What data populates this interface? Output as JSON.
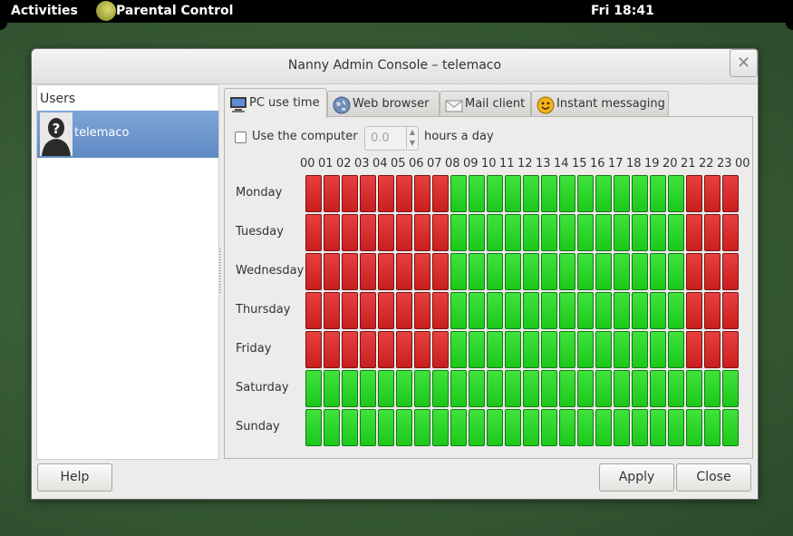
{
  "topbar": {
    "activities": "Activities",
    "app_menu": "Parental Control",
    "clock": "Fri 18:41"
  },
  "window": {
    "title": "Nanny Admin Console – telemaco",
    "close_glyph": "✕"
  },
  "users": {
    "header": "Users",
    "items": [
      {
        "name": "telemaco",
        "avatar": "unknown-user-avatar",
        "selected": true
      }
    ]
  },
  "tabs": [
    {
      "label": "PC use time",
      "icon": "computer-icon",
      "active": true
    },
    {
      "label": "Web browser",
      "icon": "globe-icon",
      "active": false
    },
    {
      "label": "Mail client",
      "icon": "envelope-icon",
      "active": false
    },
    {
      "label": "Instant messaging",
      "icon": "smiley-icon",
      "active": false
    }
  ],
  "usage": {
    "checkbox_label": "Use the computer",
    "checked": false,
    "hours_value": "0.0",
    "hours_suffix": "hours a day"
  },
  "schedule": {
    "hours": [
      "00",
      "01",
      "02",
      "03",
      "04",
      "05",
      "06",
      "07",
      "08",
      "09",
      "10",
      "11",
      "12",
      "13",
      "14",
      "15",
      "16",
      "17",
      "18",
      "19",
      "20",
      "21",
      "22",
      "23",
      "00"
    ],
    "days": [
      {
        "name": "Monday",
        "allowed": [
          0,
          0,
          0,
          0,
          0,
          0,
          0,
          0,
          1,
          1,
          1,
          1,
          1,
          1,
          1,
          1,
          1,
          1,
          1,
          1,
          1,
          0,
          0,
          0
        ]
      },
      {
        "name": "Tuesday",
        "allowed": [
          0,
          0,
          0,
          0,
          0,
          0,
          0,
          0,
          1,
          1,
          1,
          1,
          1,
          1,
          1,
          1,
          1,
          1,
          1,
          1,
          1,
          0,
          0,
          0
        ]
      },
      {
        "name": "Wednesday",
        "allowed": [
          0,
          0,
          0,
          0,
          0,
          0,
          0,
          0,
          1,
          1,
          1,
          1,
          1,
          1,
          1,
          1,
          1,
          1,
          1,
          1,
          1,
          0,
          0,
          0
        ]
      },
      {
        "name": "Thursday",
        "allowed": [
          0,
          0,
          0,
          0,
          0,
          0,
          0,
          0,
          1,
          1,
          1,
          1,
          1,
          1,
          1,
          1,
          1,
          1,
          1,
          1,
          1,
          0,
          0,
          0
        ]
      },
      {
        "name": "Friday",
        "allowed": [
          0,
          0,
          0,
          0,
          0,
          0,
          0,
          0,
          1,
          1,
          1,
          1,
          1,
          1,
          1,
          1,
          1,
          1,
          1,
          1,
          1,
          0,
          0,
          0
        ]
      },
      {
        "name": "Saturday",
        "allowed": [
          1,
          1,
          1,
          1,
          1,
          1,
          1,
          1,
          1,
          1,
          1,
          1,
          1,
          1,
          1,
          1,
          1,
          1,
          1,
          1,
          1,
          1,
          1,
          1
        ]
      },
      {
        "name": "Sunday",
        "allowed": [
          1,
          1,
          1,
          1,
          1,
          1,
          1,
          1,
          1,
          1,
          1,
          1,
          1,
          1,
          1,
          1,
          1,
          1,
          1,
          1,
          1,
          1,
          1,
          1
        ]
      }
    ],
    "colors": {
      "allowed": "#2fd62c",
      "blocked": "#d8302e"
    }
  },
  "buttons": {
    "help": "Help",
    "apply": "Apply",
    "close": "Close"
  }
}
